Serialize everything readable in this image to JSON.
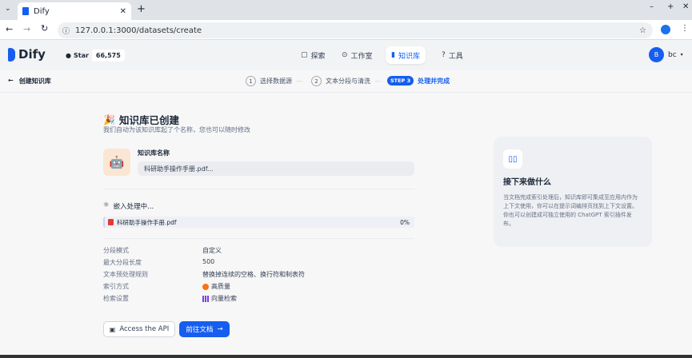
{
  "browser": {
    "tab_title": "Dify",
    "url": "127.0.0.1:3000/datasets/create"
  },
  "header": {
    "logo": "Dify",
    "star_label": "Star",
    "star_count": "66,575",
    "nav": [
      "探索",
      "工作室",
      "知识库",
      "工具"
    ],
    "user_initial": "B",
    "user_name": "bc"
  },
  "subheader": {
    "back_label": "创建知识库",
    "steps": [
      {
        "num": "1",
        "label": "选择数据源"
      },
      {
        "num": "2",
        "label": "文本分段与清洗"
      },
      {
        "num": "STEP 3",
        "label": "处理并完成"
      }
    ]
  },
  "main": {
    "title": "知识库已创建",
    "subtitle": "我们自动为该知识库起了个名称，您也可以随时修改",
    "name_label": "知识库名称",
    "name_value": "科研助手操作手册.pdf...",
    "embedding_status": "嵌入处理中...",
    "file_name": "科研助手操作手册.pdf",
    "file_progress": "0%",
    "settings": [
      {
        "label": "分段模式",
        "value": "自定义"
      },
      {
        "label": "最大分段长度",
        "value": "500"
      },
      {
        "label": "文本预处理规则",
        "value": "替换掉连续的空格、换行符和制表符"
      },
      {
        "label": "索引方式",
        "value": "高质量"
      },
      {
        "label": "检索设置",
        "value": "向量检索"
      }
    ],
    "api_button": "Access the API",
    "docs_button": "前往文档"
  },
  "side": {
    "title": "接下来做什么",
    "body": "当文档完成索引处理后，知识库即可集成至应用内作为上下文使用，你可以在提示词编排页找到上下文设置。你也可以创建成可独立使用的 ChatGPT 索引插件发布。"
  },
  "colors": {
    "accent": "#155eef",
    "quality": "#f97316",
    "vector": "#7c3aed"
  }
}
